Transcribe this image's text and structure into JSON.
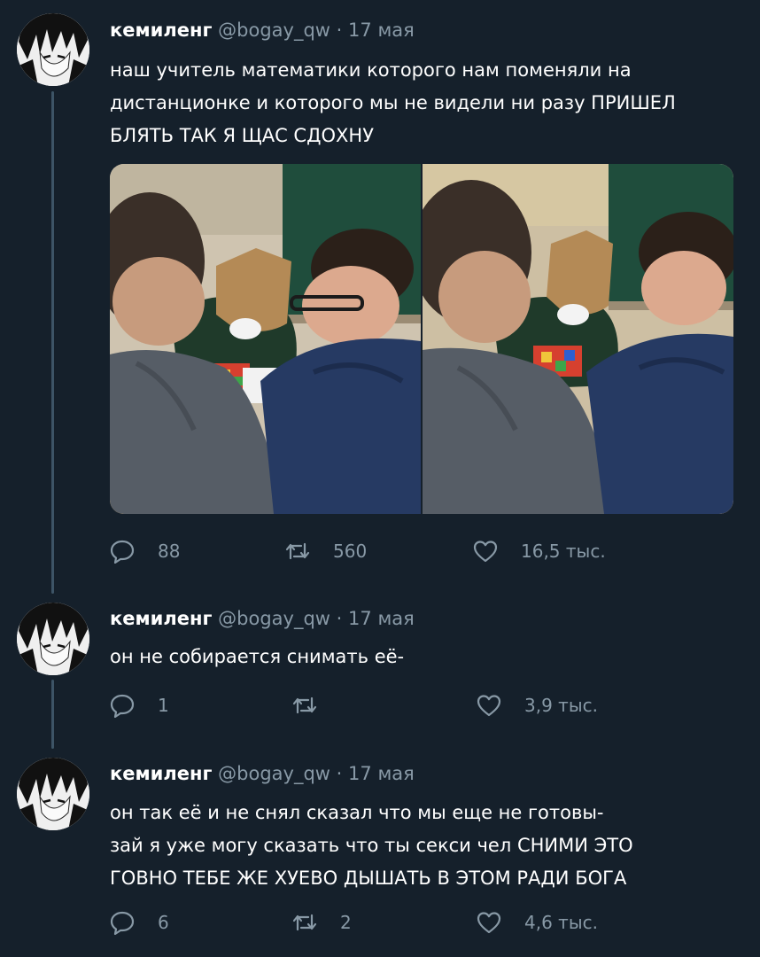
{
  "icons": {
    "reply": "reply-icon",
    "retweet": "retweet-icon",
    "like": "like-icon"
  },
  "colors": {
    "background": "#15202b",
    "secondary_text": "#8899a6",
    "thread_line": "#3d5466"
  },
  "tweets": [
    {
      "name": "кемиленг",
      "handle": "@bogay_qw",
      "separator": "·",
      "date": "17 мая",
      "lines": [
        "наш учитель математики которого нам поменяли на",
        "дистанционке и которого мы не видели ни разу ПРИШЕЛ",
        "БЛЯТЬ ТАК Я ЩАС СДОХНУ"
      ],
      "replies": "88",
      "retweets": "560",
      "likes": "16,5 тыс."
    },
    {
      "name": "кемиленг",
      "handle": "@bogay_qw",
      "separator": "·",
      "date": "17 мая",
      "lines": [
        "он не собирается снимать её-"
      ],
      "replies": "1",
      "retweets": "",
      "likes": "3,9 тыс."
    },
    {
      "name": "кемиленг",
      "handle": "@bogay_qw",
      "separator": "·",
      "date": "17 мая",
      "lines": [
        "он так её и не снял сказал что мы еще не готовы-",
        "зай я уже могу сказать что ты секси чел СНИМИ ЭТО",
        "ГОВНО ТЕБЕ ЖЕ ХУЕВО ДЫШАТЬ В ЭТОМ РАДИ БОГА"
      ],
      "replies": "6",
      "retweets": "2",
      "likes": "4,6 тыс."
    }
  ]
}
